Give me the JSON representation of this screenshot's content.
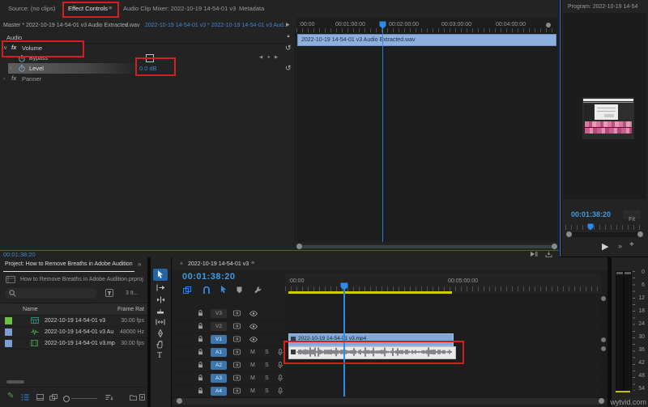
{
  "colors": {
    "accent_blue": "#2d8ceb",
    "timecode_blue": "#3f9be0",
    "annotation_red": "#d21f1f",
    "clip_blue": "#8fafdf",
    "track_target_blue": "#3d76ab",
    "work_area_yellow": "#d2cb00",
    "audio_clip_white": "#e9e9e9"
  },
  "icons": {
    "menu": "≡",
    "caret_down": "∨",
    "caret_right": "›",
    "chevron_left": "◀",
    "chevron_right": "▶",
    "keyframe_dot": "●",
    "reset": "↺",
    "scroll_up": "▲",
    "play": "▶",
    "fast_forward": "»",
    "plus": "+",
    "close": "×",
    "overflow": "»",
    "pencil": "✎",
    "type_tool": "T",
    "fx": "fx"
  },
  "effect_controls": {
    "tabs": [
      {
        "label": "Source: (no clips)"
      },
      {
        "label": "Effect Controls"
      },
      {
        "label": "Audio Clip Mixer: 2022-10-19 14-54-01 v3"
      },
      {
        "label": "Metadata"
      }
    ],
    "master_label": "Master * 2022-10-19 14-54-01 v3 Audio Extracted.wav",
    "sequence_label": "2022-10-19 14-54-01 v3 * 2022-10-19 14-54-01 v3 Aud...",
    "section_audio": "Audio",
    "volume_label": "Volume",
    "bypass_label": "Bypass",
    "level_label": "Level",
    "level_value": "0.0 dB",
    "panner_label": "Panner",
    "ruler_ticks": [
      ":00:00",
      "00:01:00:00",
      "00:02:00:00",
      "00:03:00:00",
      "00:04:00:00"
    ],
    "clip_bar_label": "2022-10-19 14-54-01 v3 Audio Extracted.wav",
    "bottom_timecode": "00:01:38:20"
  },
  "program": {
    "title": "Program: 2022-10-19 14-54",
    "timecode": "00:01:38:20",
    "fit_label": "Fit"
  },
  "project": {
    "tab_label": "Project: How to Remove Breaths in Adobe Audition",
    "breadcrumb": "How to Remove Breaths in Adobe Audition.prproj",
    "item_count": "3 It...",
    "col_name": "Name",
    "col_rate": "Frame Rat",
    "rows": [
      {
        "name": "2022-10-19 14-54-01 v3",
        "rate": "30.00 fps"
      },
      {
        "name": "2022-10-19 14-54-01 v3 Au",
        "rate": "48000 Hz"
      },
      {
        "name": "2022-10-19 14-54-01 v3.mp",
        "rate": "30.00 fps"
      }
    ]
  },
  "timeline": {
    "tab_label": "2022-10-19 14-54-01 v3",
    "timecode": "00:01:38:20",
    "ruler_tick_start": ":00:00",
    "ruler_tick_5min": "00:05:00:00",
    "video_tracks": [
      "V3",
      "V2",
      "V1"
    ],
    "audio_tracks": [
      "A1",
      "A2",
      "A3",
      "A4"
    ],
    "mute_label": "M",
    "solo_label": "S",
    "video_clip_label": "2022-10-19 14-54-01 v3.mp4"
  },
  "meters": {
    "ticks": [
      "0",
      "6",
      "12",
      "18",
      "24",
      "30",
      "36",
      "42",
      "48",
      "54"
    ]
  },
  "watermark": "wytvid.com"
}
